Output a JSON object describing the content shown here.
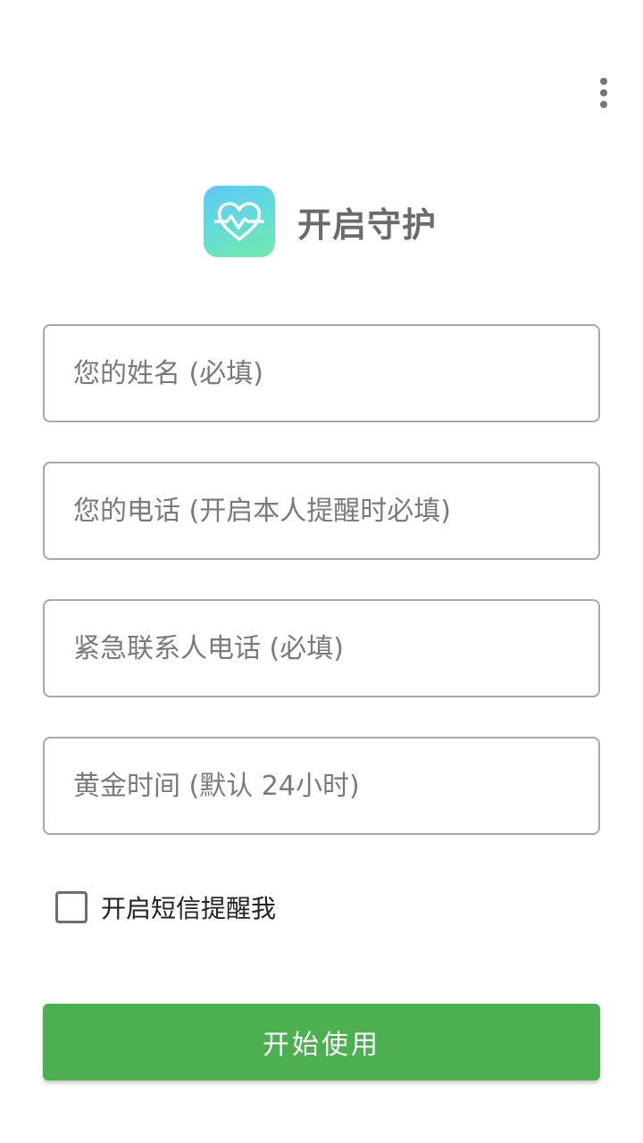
{
  "header": {
    "title": "开启守护",
    "logo_icon": "heart-pulse-icon"
  },
  "menu": {
    "icon": "more-vert-icon"
  },
  "form": {
    "name_placeholder": "您的姓名 (必填)",
    "phone_placeholder": "您的电话 (开启本人提醒时必填)",
    "emergency_placeholder": "紧急联系人电话 (必填)",
    "golden_time_placeholder": "黄金时间 (默认 24小时)",
    "sms_label": "开启短信提醒我",
    "sms_checked": false,
    "submit_label": "开始使用"
  },
  "colors": {
    "primary_button": "#4caf50",
    "field_border": "#a8a8a8",
    "placeholder_text": "#7a7a7a",
    "title_text": "#6b6b6b"
  }
}
